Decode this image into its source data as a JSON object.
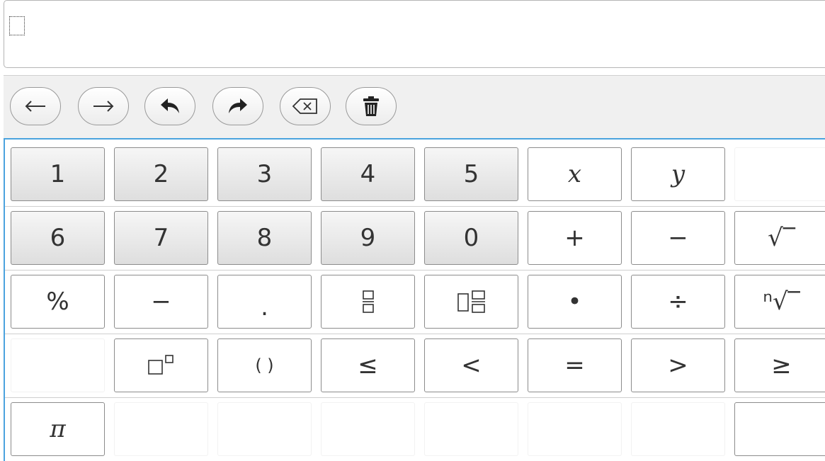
{
  "keypad": {
    "rows": [
      [
        {
          "label": "1",
          "type": "num"
        },
        {
          "label": "2",
          "type": "num"
        },
        {
          "label": "3",
          "type": "num"
        },
        {
          "label": "4",
          "type": "num"
        },
        {
          "label": "5",
          "type": "num"
        },
        {
          "label": "x",
          "type": "italic"
        },
        {
          "label": "y",
          "type": "italic"
        },
        {
          "label": "",
          "type": "empty"
        }
      ],
      [
        {
          "label": "6",
          "type": "num"
        },
        {
          "label": "7",
          "type": "num"
        },
        {
          "label": "8",
          "type": "num"
        },
        {
          "label": "9",
          "type": "num"
        },
        {
          "label": "0",
          "type": "num"
        },
        {
          "label": "+",
          "type": "op"
        },
        {
          "label": "−",
          "type": "op"
        },
        {
          "label": "√‾",
          "type": "op"
        }
      ],
      [
        {
          "label": "%",
          "type": "op"
        },
        {
          "label": "−",
          "type": "op"
        },
        {
          "label": ".",
          "type": "op"
        },
        {
          "label": "",
          "type": "fraction-icon"
        },
        {
          "label": "",
          "type": "mixed-fraction-icon"
        },
        {
          "label": "•",
          "type": "op"
        },
        {
          "label": "÷",
          "type": "op"
        },
        {
          "label": "ⁿ√‾",
          "type": "op"
        }
      ],
      [
        {
          "label": "",
          "type": "empty"
        },
        {
          "label": "",
          "type": "power-icon"
        },
        {
          "label": "( )",
          "type": "op"
        },
        {
          "label": "≤",
          "type": "op"
        },
        {
          "label": "<",
          "type": "op"
        },
        {
          "label": "=",
          "type": "op"
        },
        {
          "label": ">",
          "type": "op"
        },
        {
          "label": "≥",
          "type": "op"
        }
      ],
      [
        {
          "label": "π",
          "type": "italic"
        },
        {
          "label": "",
          "type": "empty"
        },
        {
          "label": "",
          "type": "empty"
        },
        {
          "label": "",
          "type": "empty"
        },
        {
          "label": "",
          "type": "empty"
        },
        {
          "label": "",
          "type": "empty"
        },
        {
          "label": "",
          "type": "empty"
        },
        {
          "label": "",
          "type": "op"
        }
      ]
    ]
  },
  "toolbar": {
    "buttons": [
      {
        "name": "cursor-left-button",
        "icon": "arrow-left-icon"
      },
      {
        "name": "cursor-right-button",
        "icon": "arrow-right-icon"
      },
      {
        "name": "undo-button",
        "icon": "undo-icon"
      },
      {
        "name": "redo-button",
        "icon": "redo-icon"
      },
      {
        "name": "backspace-button",
        "icon": "backspace-icon"
      },
      {
        "name": "clear-button",
        "icon": "trash-icon"
      }
    ]
  },
  "colors": {
    "keypad_border": "#4ba3de",
    "key_border": "#8c8c8c",
    "toolbar_bg": "#f0f0f0"
  }
}
